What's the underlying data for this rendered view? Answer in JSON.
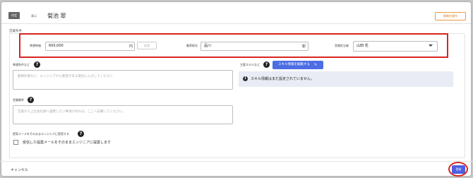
{
  "header": {
    "tag": "内定",
    "status": "表示",
    "name": "菊池 翠",
    "info_button": "情報を操作"
  },
  "section_label": "営業条件",
  "fields": {
    "desired_price_label": "希望単価",
    "desired_price_value": "600,000",
    "desired_price_unit": "円",
    "secondary_button": "交渉",
    "station_label": "最寄駅名",
    "station_value": "品川",
    "station_unit": "駅",
    "owner_label": "営業担当者",
    "owner_value": "山田 花"
  },
  "request": {
    "label": "希望条件など",
    "placeholder": "勤務形態など、エンジニアから要望がある場合に入力してください"
  },
  "skills": {
    "label": "主要スキルなど",
    "edit_button": "スキル情報を編集する",
    "info_text": "スキル情報はまだ設定されていません。"
  },
  "notes": {
    "label": "営業備考",
    "placeholder": "営業から上位会社様へ連携したい事項があれば、ここへ記載してください。"
  },
  "proposal": {
    "label": "提案メールをそのままエンジニアに提案する",
    "checkbox_label": "受信した提案メールをそのままエンジニアに提案します"
  },
  "footer": {
    "cancel": "キャンセル",
    "submit": "登録"
  }
}
